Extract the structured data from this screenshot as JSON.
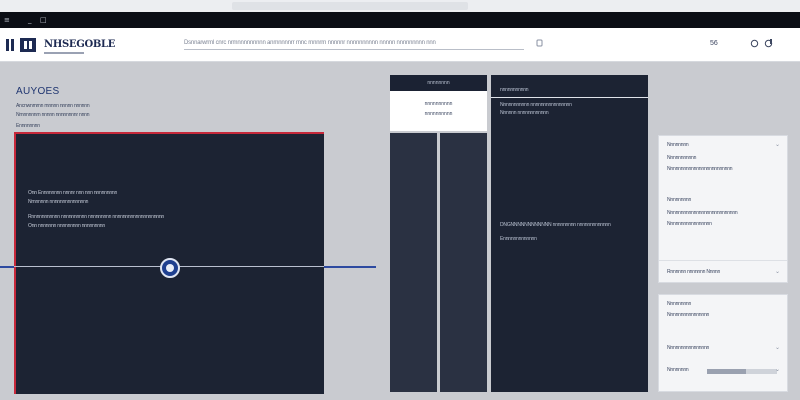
{
  "window": {
    "minimize": "_",
    "maximize": "□"
  },
  "header": {
    "brand": "NHSEGOBLE",
    "search_text": "Dsnnarwrrnl cnrc nrmnnnnnnnnn anrnnnnnrr rnnc rnnnrrn nnnnnr nnnnnnnnnn nnnnn nnnnnnnnn nnn",
    "count": "56"
  },
  "left": {
    "title": "AUYOES",
    "lines": [
      "Ancnwnmrnn mnnnn nnnnn nnnnnn",
      "Nrnnnnnnrn nnnnn nnnnnnnnr nnnn",
      "Ennnnnnnn"
    ],
    "panel_lines": [
      "Onn Ennnnnnnn nnnnr nnn nnn nnnnnnnnn",
      "Nrnnnnnn nnnnnnnnnnnnnnn",
      "Rnnnnnnnnnnn nnnnnnnnnn nnnnnnnnn nnnnnnnnnnnnnnnnnnnn",
      "Onn nnnnnnn nnnnnnnnn nnnnnnnnn"
    ]
  },
  "middle": {
    "header": "nnnnnnnn",
    "card_line1": "nnnnnnnnnn",
    "card_line2": "nnnnnnnnnn"
  },
  "right_panel": {
    "header": "nnnnnnnnnnn",
    "lines": [
      "Nnnnnnnnnnn nnnnnnnnnnnnnnnn",
      "Nnnnnn nnnnnnnnnnnn"
    ],
    "body": "DNGNNNNNNNNNNNN nnnnnnnnn nnnnnnnnnnnnn",
    "body2": "Ennnnnnnnnnnnn"
  },
  "cards": [
    {
      "title": "Nnnnnnnn",
      "lines": [
        "Nnnnnnnnnnn",
        "Nnnnnnnnnnnnnnnnnnnnnnnnn"
      ],
      "section": "Nnnnnnnnn",
      "lines2": [
        "Nnnnnnnnnnnnnnnnnnnnnnnnnnn",
        "Nnnnnnnnnnnnnnnnn"
      ],
      "footer": "Rnnnnnn nnnnnnn Nnnnn"
    },
    {
      "title": "Nnnnnnnnn",
      "lines": [
        "Nnnnnnnnnnnnnnnn"
      ],
      "section": "Nnnnnnnnnnnnnnnn",
      "progress_label": "Nnnnnnnn",
      "progress": 0.55
    }
  ],
  "colors": {
    "accent_red": "#c6283a",
    "accent_blue": "#2d4aa0",
    "panel_dark": "#1c2333"
  }
}
